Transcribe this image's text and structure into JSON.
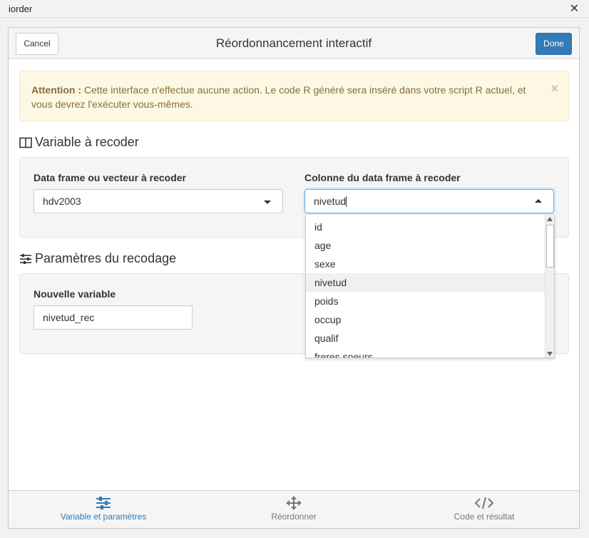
{
  "window": {
    "title": "iorder",
    "close_glyph": "✕"
  },
  "header": {
    "cancel_label": "Cancel",
    "title": "Réordonnancement interactif",
    "done_label": "Done"
  },
  "alert": {
    "strong": "Attention :",
    "text": "Cette interface n'effectue aucune action. Le code R généré sera inséré dans votre script R actuel, et vous devrez l'exécuter vous-mêmes.",
    "close_glyph": "×"
  },
  "section_variable": {
    "title": "Variable à recoder",
    "df_label": "Data frame ou vecteur à recoder",
    "df_value": "hdv2003",
    "col_label": "Colonne du data frame à recoder",
    "col_value": "nivetud"
  },
  "dropdown": {
    "options": [
      "id",
      "age",
      "sexe",
      "nivetud",
      "poids",
      "occup",
      "qualif",
      "freres.soeurs"
    ],
    "highlighted": "nivetud"
  },
  "section_params": {
    "title": "Paramètres du recodage",
    "newvar_label": "Nouvelle variable",
    "newvar_value": "nivetud_rec"
  },
  "nav": {
    "tabs": [
      {
        "label": "Variable et paramètres",
        "icon": "sliders-icon",
        "active": true
      },
      {
        "label": "Réordonner",
        "icon": "move-arrows-icon",
        "active": false
      },
      {
        "label": "Code et résultat",
        "icon": "code-icon",
        "active": false
      }
    ]
  },
  "colors": {
    "accent": "#337ab7",
    "alert_bg": "#fcf8e3",
    "alert_text": "#8a6d3b"
  }
}
